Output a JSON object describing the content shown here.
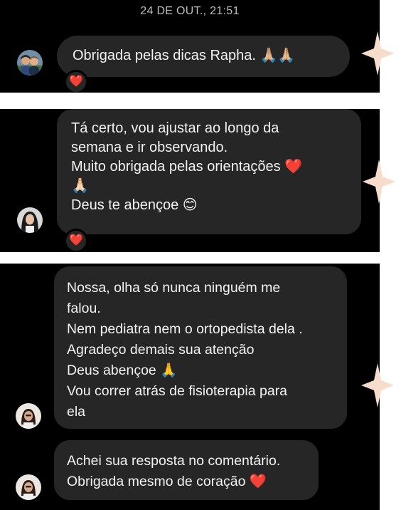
{
  "shot1": {
    "timestamp": "24 DE OUT., 21:51",
    "message": "Obrigada pelas dicas Rapha. 🙏🏼🙏🏼",
    "reaction": "❤️"
  },
  "shot2": {
    "message": "Tá certo, vou ajustar ao longo da\nsemana e ir observando.\nMuito obrigada pelas orientações ❤️\n🙏🏻\nDeus te abençoe 😊",
    "reaction": "❤️"
  },
  "shot3": {
    "message1": "Nossa, olha só nunca ninguém me\nfalou.\nNem pediatra nem o ortopedista dela .\nAgradeço demais sua atenção\nDeus abençoe 🙏\nVou correr atrás de fisioterapia para\nela",
    "message2": "Achei sua resposta no comentário.\nObrigada mesmo de coração ❤️"
  },
  "icons": [
    "avatar-couple",
    "avatar-woman",
    "heart-reaction-icon",
    "sparkle-star-icon"
  ],
  "colors": {
    "background": "#000000",
    "bubble": "#262626",
    "text": "#f2f2f2",
    "timestamp": "#bdbdbd",
    "star": "#f6dccb",
    "heart": "#e8243c"
  }
}
